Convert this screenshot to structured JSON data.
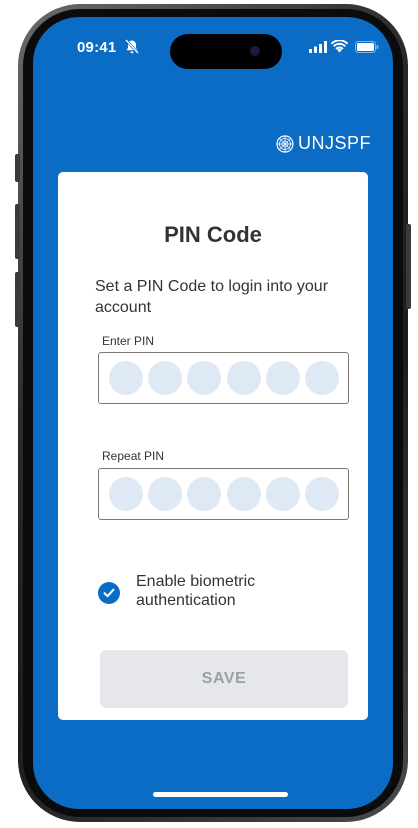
{
  "status_bar": {
    "time": "09:41",
    "icons": [
      "bell-slash-icon",
      "signal-icon",
      "wifi-icon",
      "battery-icon"
    ]
  },
  "brand": {
    "name": "UNJSPF",
    "icon": "un-emblem-icon"
  },
  "card": {
    "title": "PIN Code",
    "description": "Set a PIN Code to login into your account",
    "enter_pin_label": "Enter PIN",
    "repeat_pin_label": "Repeat PIN",
    "pin_length": 6,
    "biometric_label": "Enable biometric authentication",
    "biometric_checked": true,
    "save_label": "SAVE"
  },
  "colors": {
    "primary": "#0b6cc6",
    "pin_dot": "#dfe9f6",
    "button_disabled_bg": "#e6e7ea",
    "button_disabled_text": "#9aa0a8"
  }
}
